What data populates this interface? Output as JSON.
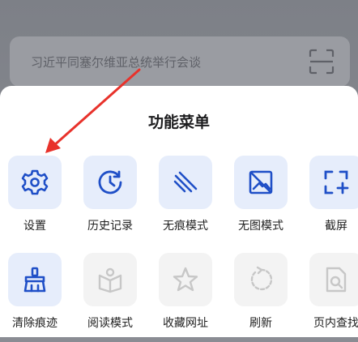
{
  "search": {
    "query": "习近平同塞尔维亚总统举行会谈",
    "scan_icon": "scan-icon"
  },
  "menu": {
    "title": "功能菜单",
    "items": [
      {
        "label": "设置",
        "icon": "gear-icon",
        "active": true
      },
      {
        "label": "历史记录",
        "icon": "history-icon",
        "active": true
      },
      {
        "label": "无痕模式",
        "icon": "incognito-icon",
        "active": true
      },
      {
        "label": "无图模式",
        "icon": "no-image-icon",
        "active": true
      },
      {
        "label": "截屏",
        "icon": "screenshot-icon",
        "active": true
      },
      {
        "label": "清除痕迹",
        "icon": "broom-icon",
        "active": true
      },
      {
        "label": "阅读模式",
        "icon": "reading-icon",
        "active": false
      },
      {
        "label": "收藏网址",
        "icon": "star-icon",
        "active": false
      },
      {
        "label": "刷新",
        "icon": "refresh-icon",
        "active": false
      },
      {
        "label": "页内查找",
        "icon": "find-in-page-icon",
        "active": false
      }
    ]
  },
  "colors": {
    "accent": "#1f4fc7",
    "disabled_icon": "#c7c7c7",
    "annotation_arrow": "#e8322b"
  }
}
